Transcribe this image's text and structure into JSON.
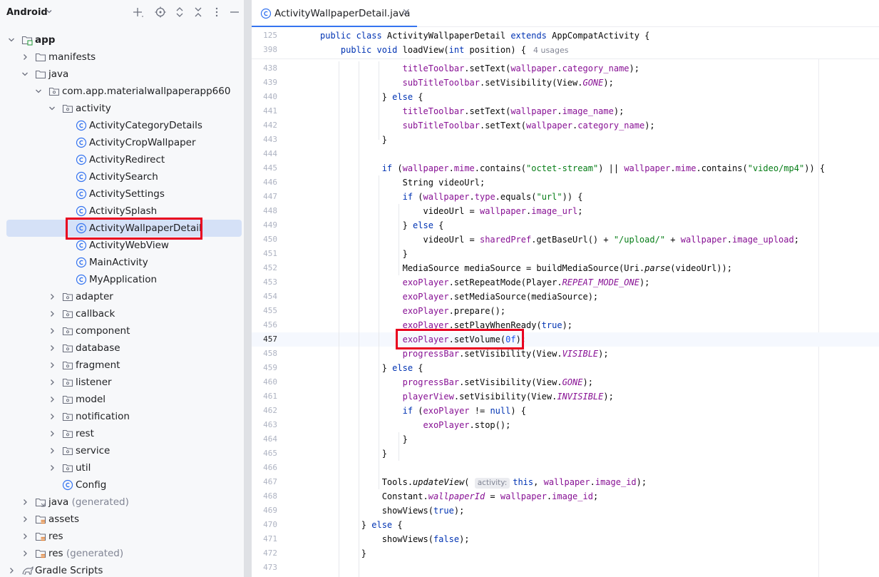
{
  "panel": {
    "title": "Android",
    "icons": [
      "add-icon",
      "target-icon",
      "expand-icon",
      "collapse-icon",
      "more-icon",
      "minimize-icon"
    ]
  },
  "tree": [
    {
      "label": "app",
      "suffix": "",
      "depth": 0,
      "expanded": true,
      "icon": "module-icon",
      "bold": true
    },
    {
      "label": "manifests",
      "suffix": "",
      "depth": 1,
      "expanded": false,
      "icon": "folder-icon"
    },
    {
      "label": "java",
      "suffix": "",
      "depth": 1,
      "expanded": true,
      "icon": "folder-icon"
    },
    {
      "label": "com.app.materialwallpaperapp660",
      "suffix": "",
      "depth": 2,
      "expanded": true,
      "icon": "package-icon"
    },
    {
      "label": "activity",
      "suffix": "",
      "depth": 3,
      "expanded": true,
      "icon": "package-icon"
    },
    {
      "label": "ActivityCategoryDetails",
      "suffix": "",
      "depth": 4,
      "icon": "class-icon"
    },
    {
      "label": "ActivityCropWallpaper",
      "suffix": "",
      "depth": 4,
      "icon": "class-icon"
    },
    {
      "label": "ActivityRedirect",
      "suffix": "",
      "depth": 4,
      "icon": "class-icon"
    },
    {
      "label": "ActivitySearch",
      "suffix": "",
      "depth": 4,
      "icon": "class-icon"
    },
    {
      "label": "ActivitySettings",
      "suffix": "",
      "depth": 4,
      "icon": "class-icon"
    },
    {
      "label": "ActivitySplash",
      "suffix": "",
      "depth": 4,
      "icon": "class-icon"
    },
    {
      "label": "ActivityWallpaperDetail",
      "suffix": "",
      "depth": 4,
      "icon": "class-icon",
      "selected": true
    },
    {
      "label": "ActivityWebView",
      "suffix": "",
      "depth": 4,
      "icon": "class-icon"
    },
    {
      "label": "MainActivity",
      "suffix": "",
      "depth": 4,
      "icon": "class-icon"
    },
    {
      "label": "MyApplication",
      "suffix": "",
      "depth": 4,
      "icon": "class-icon"
    },
    {
      "label": "adapter",
      "suffix": "",
      "depth": 3,
      "expanded": false,
      "icon": "package-icon"
    },
    {
      "label": "callback",
      "suffix": "",
      "depth": 3,
      "expanded": false,
      "icon": "package-icon"
    },
    {
      "label": "component",
      "suffix": "",
      "depth": 3,
      "expanded": false,
      "icon": "package-icon"
    },
    {
      "label": "database",
      "suffix": "",
      "depth": 3,
      "expanded": false,
      "icon": "package-icon"
    },
    {
      "label": "fragment",
      "suffix": "",
      "depth": 3,
      "expanded": false,
      "icon": "package-icon"
    },
    {
      "label": "listener",
      "suffix": "",
      "depth": 3,
      "expanded": false,
      "icon": "package-icon"
    },
    {
      "label": "model",
      "suffix": "",
      "depth": 3,
      "expanded": false,
      "icon": "package-icon"
    },
    {
      "label": "notification",
      "suffix": "",
      "depth": 3,
      "expanded": false,
      "icon": "package-icon"
    },
    {
      "label": "rest",
      "suffix": "",
      "depth": 3,
      "expanded": false,
      "icon": "package-icon"
    },
    {
      "label": "service",
      "suffix": "",
      "depth": 3,
      "expanded": false,
      "icon": "package-icon"
    },
    {
      "label": "util",
      "suffix": "",
      "depth": 3,
      "expanded": false,
      "icon": "package-icon"
    },
    {
      "label": "Config",
      "suffix": "",
      "depth": 3,
      "icon": "class-icon"
    },
    {
      "label": "java",
      "suffix": " (generated)",
      "depth": 1,
      "expanded": false,
      "icon": "folder-gen-icon"
    },
    {
      "label": "assets",
      "suffix": "",
      "depth": 1,
      "expanded": false,
      "icon": "folder-res-icon"
    },
    {
      "label": "res",
      "suffix": "",
      "depth": 1,
      "expanded": false,
      "icon": "folder-res-icon"
    },
    {
      "label": "res",
      "suffix": " (generated)",
      "depth": 1,
      "expanded": false,
      "icon": "folder-res-icon"
    },
    {
      "label": "Gradle Scripts",
      "suffix": "",
      "depth": 0,
      "expanded": false,
      "icon": "gradle-icon"
    }
  ],
  "editor": {
    "tab_label": "ActivityWallpaperDetail.java",
    "tab_icon": "class-icon",
    "close_icon": "close-icon",
    "sticky": [
      {
        "num": "125",
        "html": "<span class=\"kw\">public class</span> ActivityWallpaperDetail <span class=\"kw\">extends</span> AppCompatActivity {"
      },
      {
        "num": "398",
        "html": "    <span class=\"kw\">public void</span> loadView(<span class=\"kw\">int</span> position) {<span class=\"usages\">4 usages</span>"
      }
    ],
    "lines": [
      {
        "num": "438",
        "html": "                <span class=\"fld\">titleToolbar</span>.setText(<span class=\"fld\">wallpaper</span>.<span class=\"fld\">category_name</span>);"
      },
      {
        "num": "439",
        "html": "                <span class=\"fld\">subTitleToolbar</span>.setVisibility(View.<span class=\"cst\">GONE</span>);"
      },
      {
        "num": "440",
        "html": "            } <span class=\"kw\">else</span> {"
      },
      {
        "num": "441",
        "html": "                <span class=\"fld\">titleToolbar</span>.setText(<span class=\"fld\">wallpaper</span>.<span class=\"fld\">image_name</span>);"
      },
      {
        "num": "442",
        "html": "                <span class=\"fld\">subTitleToolbar</span>.setText(<span class=\"fld\">wallpaper</span>.<span class=\"fld\">category_name</span>);"
      },
      {
        "num": "443",
        "html": "            }"
      },
      {
        "num": "444",
        "html": ""
      },
      {
        "num": "445",
        "html": "            <span class=\"kw\">if</span> (<span class=\"fld\">wallpaper</span>.<span class=\"fld\">mime</span>.contains(<span class=\"str\">\"octet-stream\"</span>) || <span class=\"fld\">wallpaper</span>.<span class=\"fld\">mime</span>.contains(<span class=\"str\">\"video/mp4\"</span>)) {"
      },
      {
        "num": "446",
        "html": "                String videoUrl;"
      },
      {
        "num": "447",
        "html": "                <span class=\"kw\">if</span> (<span class=\"fld\">wallpaper</span>.<span class=\"fld\">type</span>.equals(<span class=\"str\">\"url\"</span>)) {"
      },
      {
        "num": "448",
        "html": "                    videoUrl = <span class=\"fld\">wallpaper</span>.<span class=\"fld\">image_url</span>;"
      },
      {
        "num": "449",
        "html": "                } <span class=\"kw\">else</span> {"
      },
      {
        "num": "450",
        "html": "                    videoUrl = <span class=\"fld\">sharedPref</span>.getBaseUrl() + <span class=\"str\">\"/upload/\"</span> + <span class=\"fld\">wallpaper</span>.<span class=\"fld\">image_upload</span>;"
      },
      {
        "num": "451",
        "html": "                }"
      },
      {
        "num": "452",
        "html": "                MediaSource mediaSource = buildMediaSource(Uri.<span class=\"ital\">parse</span>(videoUrl));"
      },
      {
        "num": "453",
        "html": "                <span class=\"fld\">exoPlayer</span>.setRepeatMode(Player.<span class=\"cst\">REPEAT_MODE_ONE</span>);"
      },
      {
        "num": "454",
        "html": "                <span class=\"fld\">exoPlayer</span>.setMediaSource(mediaSource);"
      },
      {
        "num": "455",
        "html": "                <span class=\"fld\">exoPlayer</span>.prepare();"
      },
      {
        "num": "456",
        "html": "                <span class=\"fld\">exoPlayer</span>.setPlayWhenReady(<span class=\"kw\">true</span>);"
      },
      {
        "num": "457",
        "html": "                <span class=\"fld\">exoPlayer</span>.setVolume(<span class=\"num\">0f</span>);",
        "current": true
      },
      {
        "num": "458",
        "html": "                <span class=\"fld\">progressBar</span>.setVisibility(View.<span class=\"cst\">VISIBLE</span>);"
      },
      {
        "num": "459",
        "html": "            } <span class=\"kw\">else</span> {"
      },
      {
        "num": "460",
        "html": "                <span class=\"fld\">progressBar</span>.setVisibility(View.<span class=\"cst\">GONE</span>);"
      },
      {
        "num": "461",
        "html": "                <span class=\"fld\">playerView</span>.setVisibility(View.<span class=\"cst\">INVISIBLE</span>);"
      },
      {
        "num": "462",
        "html": "                <span class=\"kw\">if</span> (<span class=\"fld\">exoPlayer</span> != <span class=\"kw\">null</span>) {"
      },
      {
        "num": "463",
        "html": "                    <span class=\"fld\">exoPlayer</span>.stop();"
      },
      {
        "num": "464",
        "html": "                }"
      },
      {
        "num": "465",
        "html": "            }"
      },
      {
        "num": "466",
        "html": ""
      },
      {
        "num": "467",
        "html": "            Tools.<span class=\"ital\">updateView</span>( <span class=\"hint\">activity:</span><span class=\"kw\">this</span>, <span class=\"fld\">wallpaper</span>.<span class=\"fld\">image_id</span>);"
      },
      {
        "num": "468",
        "html": "            Constant.<span class=\"cst\">wallpaperId</span> = <span class=\"fld\">wallpaper</span>.<span class=\"fld\">image_id</span>;"
      },
      {
        "num": "469",
        "html": "            showViews(<span class=\"kw\">true</span>);"
      },
      {
        "num": "470",
        "html": "        } <span class=\"kw\">else</span> {"
      },
      {
        "num": "471",
        "html": "            showViews(<span class=\"kw\">false</span>);"
      },
      {
        "num": "472",
        "html": "        }"
      },
      {
        "num": "473",
        "html": ""
      }
    ]
  },
  "colors": {
    "accent": "#3574f0",
    "highlight_box": "#e8001f",
    "selection": "#d5e1f7"
  }
}
